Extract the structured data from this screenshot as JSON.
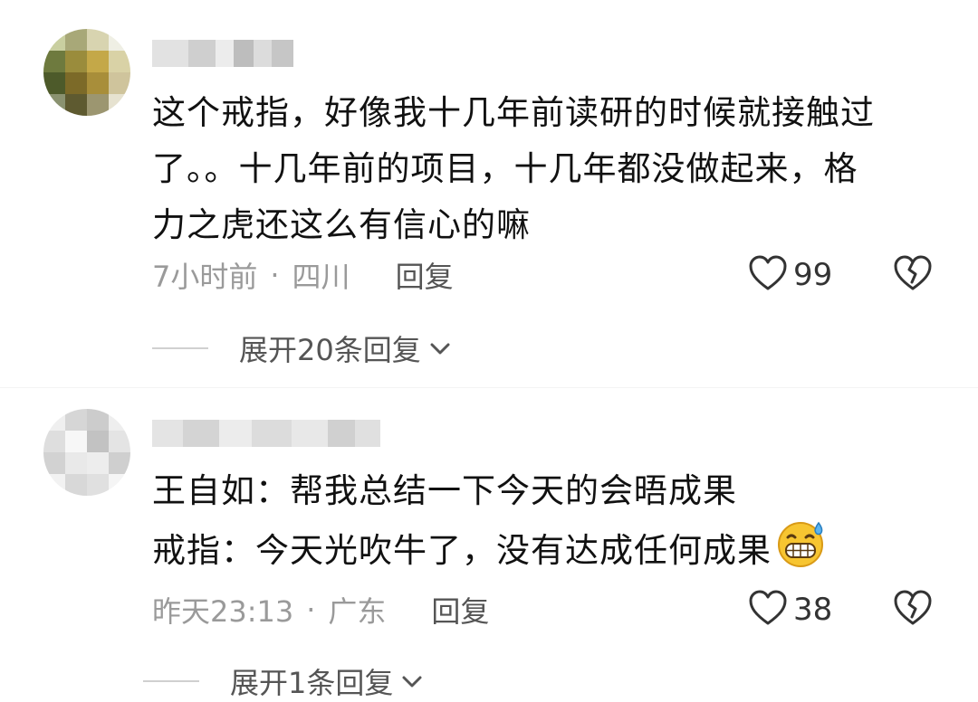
{
  "comments": [
    {
      "content_lines": [
        "这个戒指，好像我十几年前读研的时候就接触过",
        "了。。十几年前的项目，十几年都没做起来，格",
        "力之虎还这么有信心的嘛"
      ],
      "time": "7小时前",
      "separator": "·",
      "location": "四川",
      "reply_label": "回复",
      "likes": "99",
      "expand_label": "展开20条回复"
    },
    {
      "content_lines": [
        "王自如：帮我总结一下今天的会晤成果",
        "戒指：今天光吹牛了，没有达成任何成果"
      ],
      "emoji": "grinning-sweat-emoji",
      "time": "昨天23:13",
      "separator": "·",
      "location": "广东",
      "reply_label": "回复",
      "likes": "38",
      "expand_label": "展开1条回复"
    }
  ],
  "colors": {
    "text": "#111111",
    "meta": "#9a9a9a",
    "secondary": "#555555"
  }
}
